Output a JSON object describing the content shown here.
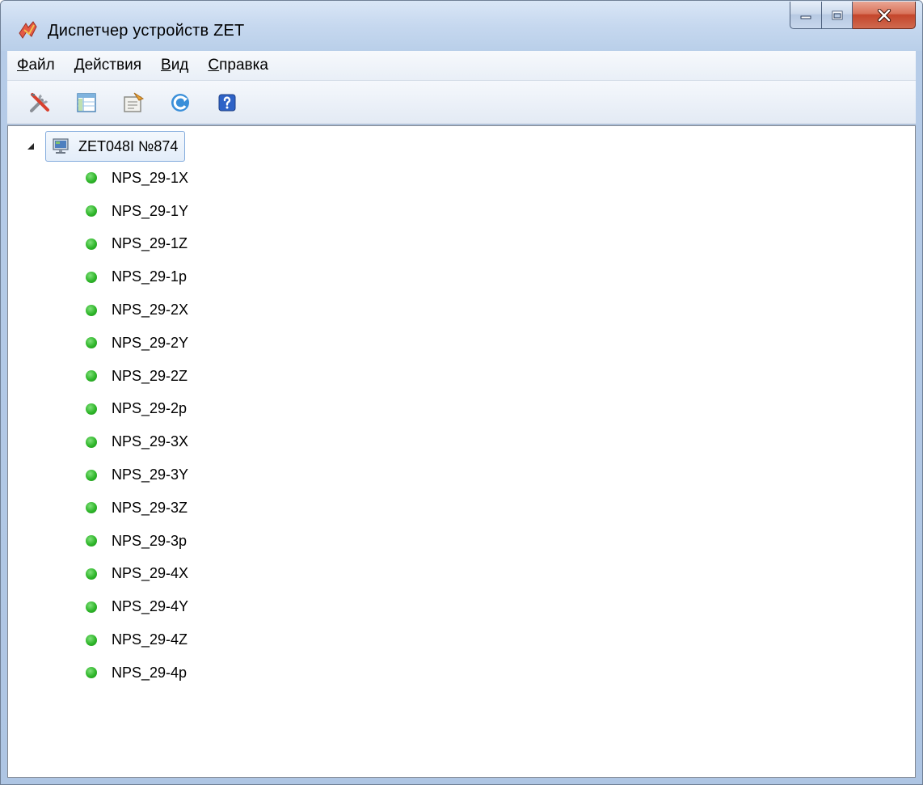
{
  "window": {
    "title": "Диспетчер устройств ZET"
  },
  "menu": [
    {
      "accel": "Ф",
      "rest": "айл"
    },
    {
      "accel": "Д",
      "rest": "ействия"
    },
    {
      "accel": "В",
      "rest": "ид"
    },
    {
      "accel": "С",
      "rest": "правка"
    }
  ],
  "toolbar": {
    "buttons": [
      "tools-icon",
      "table-view-icon",
      "properties-icon",
      "refresh-icon",
      "help-icon"
    ]
  },
  "tree": {
    "root": {
      "label": "ZET048I №874",
      "expanded": true
    },
    "children": [
      "NPS_29-1X",
      "NPS_29-1Y",
      "NPS_29-1Z",
      "NPS_29-1p",
      "NPS_29-2X",
      "NPS_29-2Y",
      "NPS_29-2Z",
      "NPS_29-2p",
      "NPS_29-3X",
      "NPS_29-3Y",
      "NPS_29-3Z",
      "NPS_29-3p",
      "NPS_29-4X",
      "NPS_29-4Y",
      "NPS_29-4Z",
      "NPS_29-4p"
    ],
    "status_color": "#2fb62a"
  }
}
